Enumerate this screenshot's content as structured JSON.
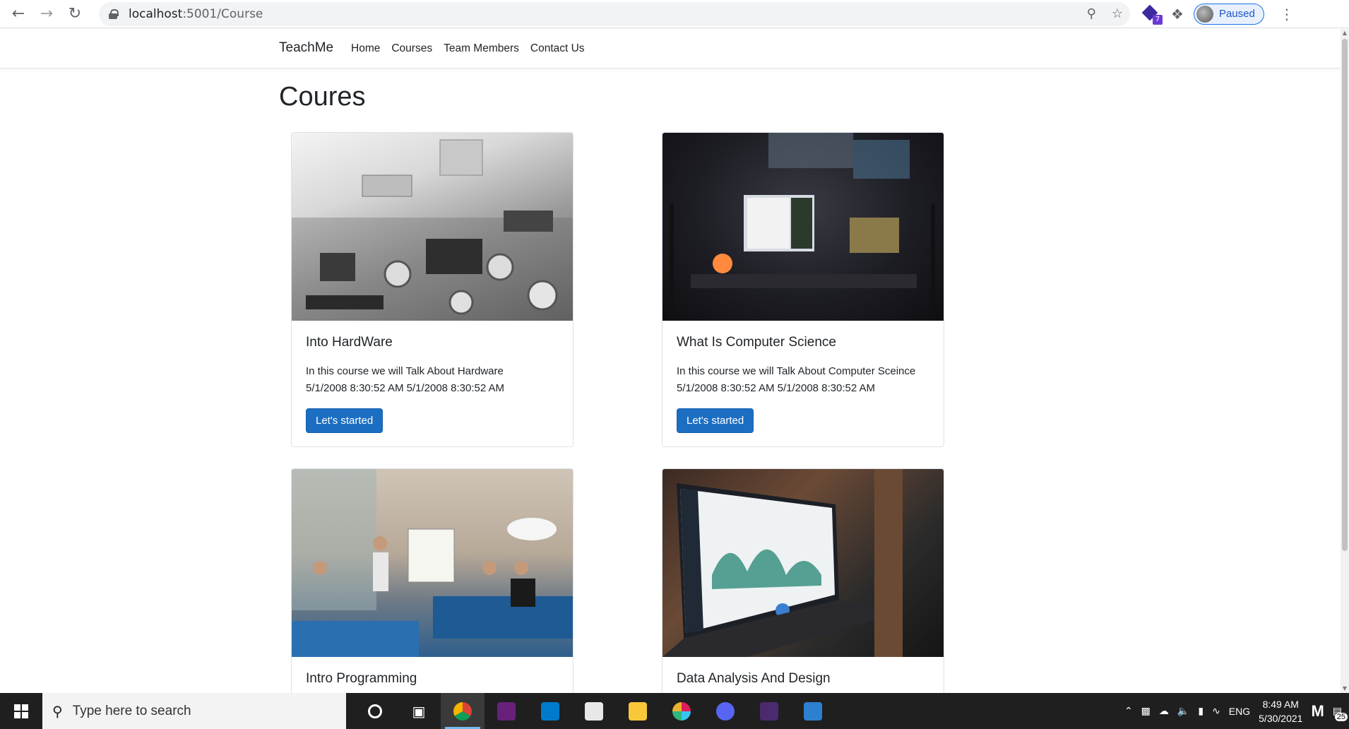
{
  "browser": {
    "url_host": "localhost",
    "url_path": ":5001/Course",
    "profile_label": "Paused",
    "extension_badge": "7"
  },
  "site": {
    "brand": "TeachMe",
    "nav": [
      "Home",
      "Courses",
      "Team Members",
      "Contact Us"
    ],
    "page_title": "Coures"
  },
  "courses": [
    {
      "title": "Into HardWare",
      "description": "In this course we will Talk About Hardware",
      "dates": "5/1/2008 8:30:52 AM 5/1/2008 8:30:52 AM",
      "button": "Let's started",
      "image": "circuit-board-photo"
    },
    {
      "title": "What Is Computer Science",
      "description": "In this course we will Talk About Computer Sceince",
      "dates": "5/1/2008 8:30:52 AM 5/1/2008 8:30:52 AM",
      "button": "Let's started",
      "image": "desk-setup-photo"
    },
    {
      "title": "Intro Programming",
      "image": "team-meeting-photo"
    },
    {
      "title": "Data Analysis And Design",
      "image": "laptop-dashboard-photo"
    }
  ],
  "taskbar": {
    "search_placeholder": "Type here to search",
    "language": "ENG",
    "time": "8:49 AM",
    "date": "5/30/2021",
    "notification_count": "25"
  }
}
